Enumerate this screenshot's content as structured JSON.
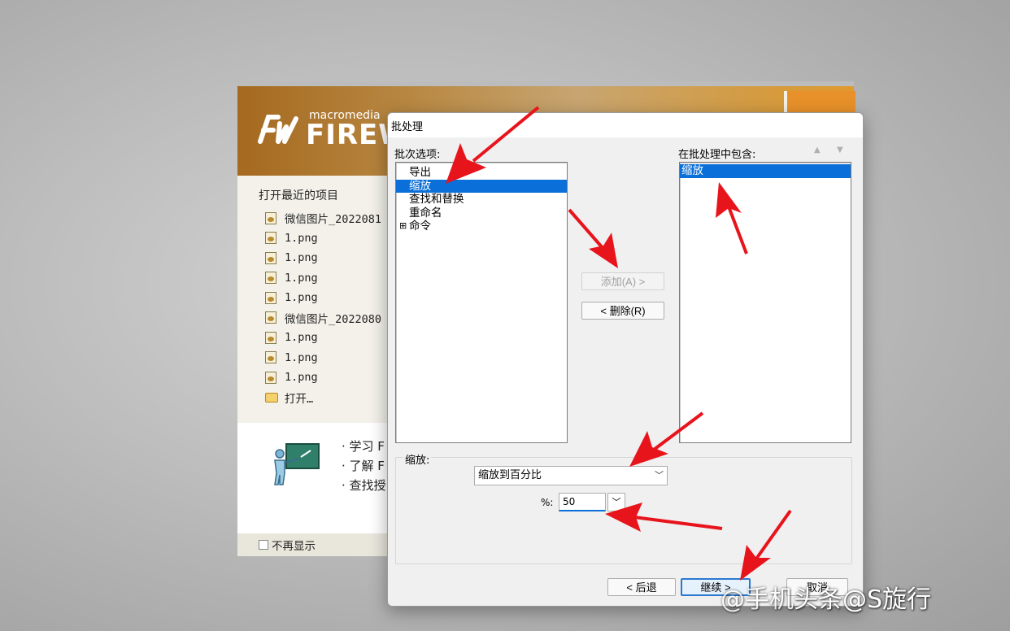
{
  "fireworks": {
    "logo_small": "macromedia",
    "logo_word": "FIREW",
    "recent_title": "打开最近的项目",
    "recent_items": [
      "微信图片_2022081",
      "1.png",
      "1.png",
      "1.png",
      "1.png",
      "微信图片_2022080",
      "1.png",
      "1.png",
      "1.png"
    ],
    "open_label": "打开…",
    "learn_links": [
      "· 学习 F",
      "· 了解 F",
      "· 查找授"
    ],
    "dont_show": "不再显示",
    "accent_color": "#e8912a"
  },
  "dialog": {
    "title": "批处理",
    "options_label": "批次选项:",
    "options": [
      "导出",
      "缩放",
      "查找和替换",
      "重命名",
      "命令"
    ],
    "selected_option": "缩放",
    "command_expander": "⊞",
    "included_label": "在批处理中包含:",
    "included": [
      "缩放"
    ],
    "add_button": "添加(A) >",
    "remove_button": "< 删除(R)",
    "scale_label": "缩放:",
    "scale_mode": "缩放到百分比",
    "percent_label": "%:",
    "percent_value": "50",
    "back_button": "< 后退",
    "continue_button": "继续 >",
    "cancel_button": "取消",
    "selection_color": "#0a6fd8"
  },
  "watermark": "头条@S旋行",
  "watermark_prefix": "@手机",
  "annotation_color": "#e8141c"
}
